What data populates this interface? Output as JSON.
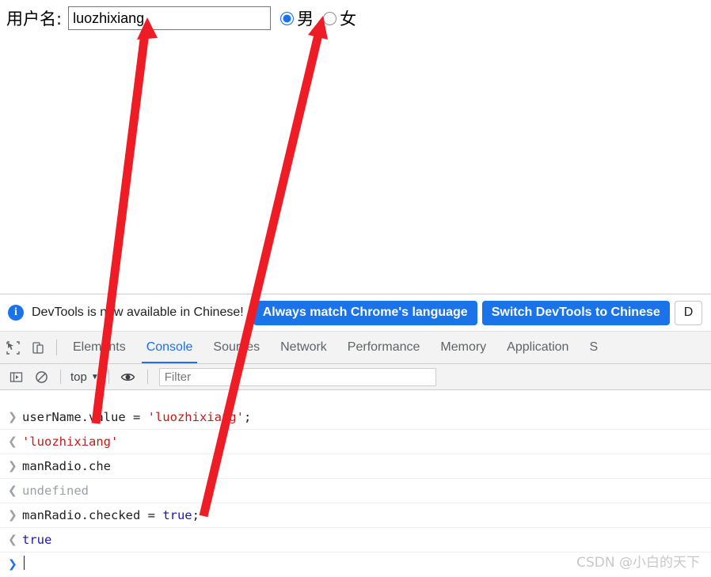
{
  "page": {
    "username_label": "用户名:",
    "username_value": "luozhixiang",
    "username_placeholder": "",
    "gender": {
      "male_label": "男",
      "female_label": "女",
      "male_checked": true,
      "female_checked": false
    }
  },
  "devtools": {
    "notification": {
      "icon": "info-icon",
      "message": "DevTools is now available in Chinese!",
      "buttons": [
        {
          "label": "Always match Chrome's language",
          "style": "primary"
        },
        {
          "label": "Switch DevTools to Chinese",
          "style": "primary"
        },
        {
          "label": "D",
          "style": "secondary"
        }
      ]
    },
    "toolbar_icons": {
      "inspect": "inspect-element-icon",
      "device": "device-toolbar-icon"
    },
    "tabs": [
      {
        "label": "Elements",
        "active": false
      },
      {
        "label": "Console",
        "active": true
      },
      {
        "label": "Sources",
        "active": false
      },
      {
        "label": "Network",
        "active": false
      },
      {
        "label": "Performance",
        "active": false
      },
      {
        "label": "Memory",
        "active": false
      },
      {
        "label": "Application",
        "active": false
      },
      {
        "label": "S",
        "active": false
      }
    ],
    "console_toolbar": {
      "sidebar_icon": "console-sidebar-icon",
      "clear_icon": "clear-console-icon",
      "context": "top",
      "caret": "▼",
      "eye_icon": "eye-icon",
      "filter_placeholder": "Filter",
      "filter_value": ""
    },
    "console_entries": [
      {
        "kind": "input",
        "marker": ">",
        "tokens": [
          {
            "text": "userName.value = ",
            "type": "plain"
          },
          {
            "text": "'luozhixiang'",
            "type": "string"
          },
          {
            "text": ";",
            "type": "plain"
          }
        ]
      },
      {
        "kind": "output",
        "marker": "<",
        "value": "'luozhixiang'",
        "value_type": "string"
      },
      {
        "kind": "input",
        "marker": ">",
        "tokens": [
          {
            "text": "manRadio.che",
            "type": "plain"
          }
        ]
      },
      {
        "kind": "output",
        "marker": "<",
        "value": "undefined",
        "value_type": "undefined"
      },
      {
        "kind": "input",
        "marker": ">",
        "tokens": [
          {
            "text": "manRadio.checked = ",
            "type": "plain"
          },
          {
            "text": "true",
            "type": "keyword"
          },
          {
            "text": ";",
            "type": "plain"
          }
        ]
      },
      {
        "kind": "output",
        "marker": "<",
        "value": "true",
        "value_type": "boolean"
      }
    ],
    "prompt": {
      "marker": ">",
      "value": ""
    }
  },
  "watermark": "CSDN @小白的天下",
  "annotations": [
    {
      "name": "arrow-to-username-input",
      "color": "#ee1c25"
    },
    {
      "name": "arrow-to-male-radio",
      "color": "#ee1c25"
    }
  ],
  "colors": {
    "accent_blue": "#1a73e8",
    "annotation_red": "#ee1c25",
    "string_red": "#c41a16",
    "keyword_blue": "#1a1aa6",
    "muted_gray": "#9aa0a6"
  }
}
